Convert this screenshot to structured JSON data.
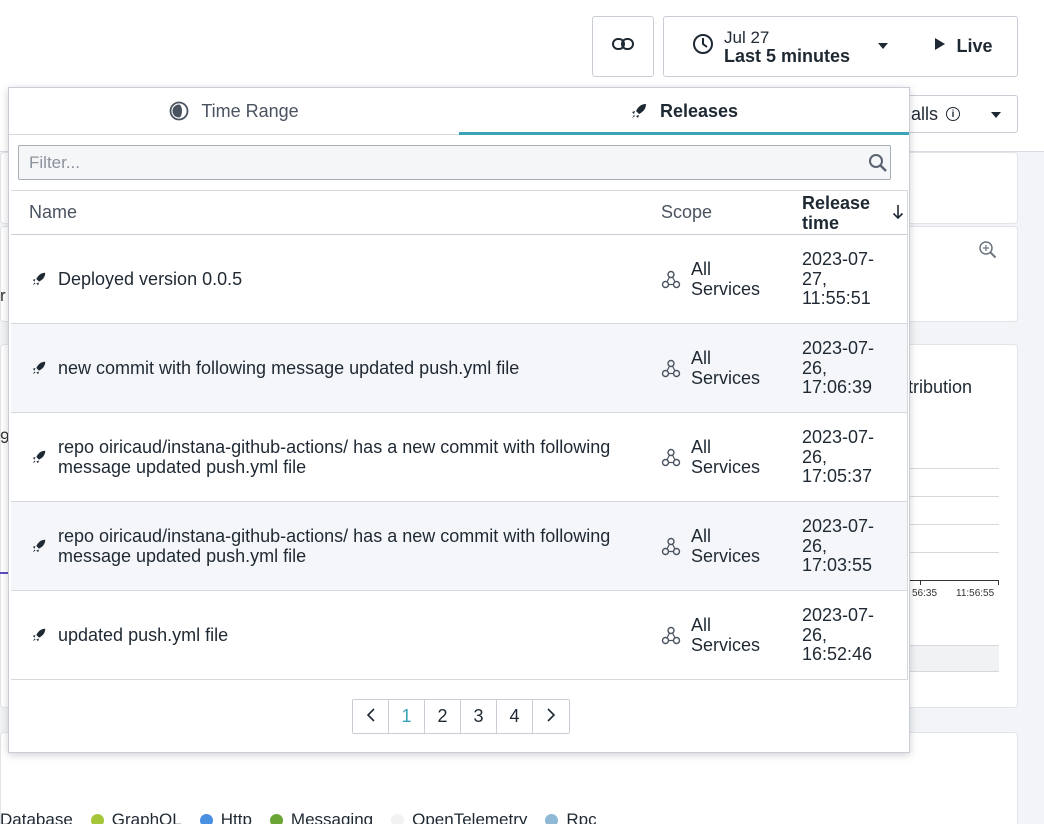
{
  "topbar": {
    "time_date": "Jul 27",
    "time_range": "Last 5 minutes",
    "live_label": "Live",
    "calls_label": "alls"
  },
  "background": {
    "partial_r": "r",
    "partial_9": "9",
    "dist_title": "tribution",
    "axis_ticks": [
      "56:35",
      "11:56:55"
    ],
    "legend": [
      {
        "label": "Database",
        "color": "#ffffff"
      },
      {
        "label": "GraphQL",
        "color": "#a6c63a"
      },
      {
        "label": "Http",
        "color": "#4a90e2"
      },
      {
        "label": "Messaging",
        "color": "#6aa535"
      },
      {
        "label": "OpenTelemetry",
        "color": "#f2f2f2"
      },
      {
        "label": "Rpc",
        "color": "#8fb9d6"
      }
    ]
  },
  "popover": {
    "tabs": [
      {
        "label": "Time Range",
        "icon": "time-range-icon",
        "active": false
      },
      {
        "label": "Releases",
        "icon": "rocket-icon",
        "active": true
      }
    ],
    "filter_placeholder": "Filter...",
    "columns": {
      "name": "Name",
      "scope": "Scope",
      "release_time": "Release time"
    },
    "rows": [
      {
        "name": "Deployed version 0.0.5",
        "scope": "All Services",
        "time": "2023-07-27, 11:55:51"
      },
      {
        "name": "new commit with following message updated push.yml file",
        "scope": "All Services",
        "time": "2023-07-26, 17:06:39"
      },
      {
        "name": "repo oiricaud/instana-github-actions/ has a new commit with following message updated push.yml file",
        "scope": "All Services",
        "time": "2023-07-26, 17:05:37"
      },
      {
        "name": "repo oiricaud/instana-github-actions/ has a new commit with following message updated push.yml file",
        "scope": "All Services",
        "time": "2023-07-26, 17:03:55"
      },
      {
        "name": "updated push.yml file",
        "scope": "All Services",
        "time": "2023-07-26, 16:52:46"
      }
    ],
    "pagination": {
      "pages": [
        "1",
        "2",
        "3",
        "4"
      ],
      "current": "1"
    }
  },
  "colors": {
    "accent": "#3aa3b7"
  }
}
